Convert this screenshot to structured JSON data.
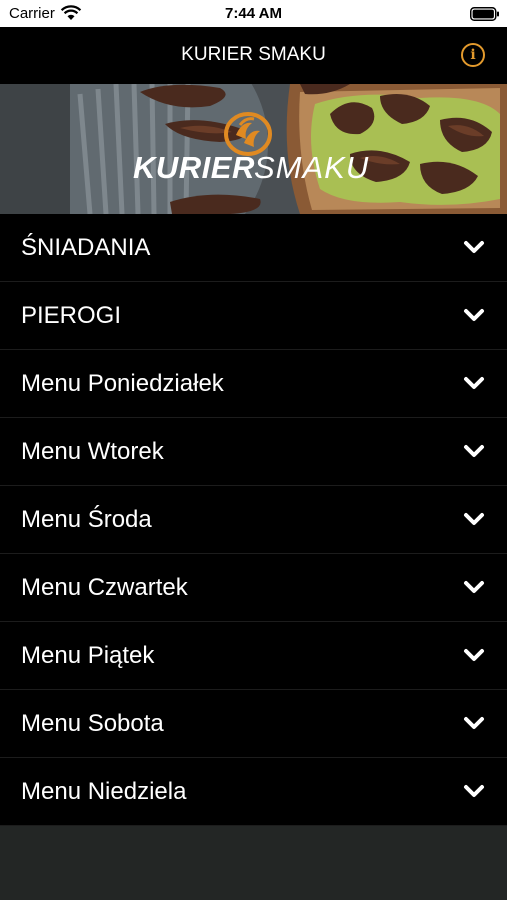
{
  "status_bar": {
    "carrier": "Carrier",
    "time": "7:44 AM"
  },
  "nav": {
    "title": "KURIER SMAKU",
    "info_icon": "info-icon",
    "accent": "#e39a2d"
  },
  "banner": {
    "logo_part1": "KURIER",
    "logo_part2": "SMAKU"
  },
  "menu": {
    "items": [
      {
        "label": "ŚNIADANIA"
      },
      {
        "label": "PIEROGI"
      },
      {
        "label": "Menu Poniedziałek"
      },
      {
        "label": "Menu Wtorek"
      },
      {
        "label": "Menu Środa"
      },
      {
        "label": "Menu Czwartek"
      },
      {
        "label": "Menu Piątek"
      },
      {
        "label": "Menu Sobota"
      },
      {
        "label": "Menu Niedziela"
      }
    ]
  },
  "colors": {
    "row_bg": "#000000",
    "page_bg": "#232625",
    "text": "#ffffff"
  }
}
